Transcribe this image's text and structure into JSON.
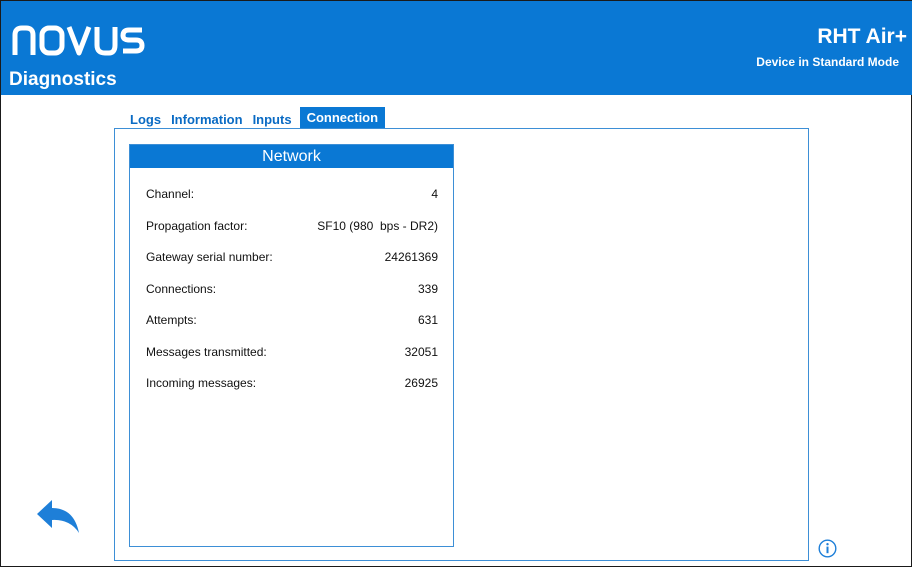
{
  "header": {
    "logo_text": "NOVUS",
    "page_title": "Diagnostics",
    "device_name": "RHT Air+",
    "device_mode": "Device in Standard Mode"
  },
  "tabs": [
    {
      "label": "Logs",
      "active": false
    },
    {
      "label": "Information",
      "active": false
    },
    {
      "label": "Inputs",
      "active": false
    },
    {
      "label": "Connection",
      "active": true
    }
  ],
  "network": {
    "title": "Network",
    "rows": [
      {
        "label": "Channel:",
        "value": "4"
      },
      {
        "label": "Propagation factor:",
        "value": "SF10 (980  bps - DR2)"
      },
      {
        "label": "Gateway serial number:",
        "value": "24261369"
      },
      {
        "label": "Connections:",
        "value": "339"
      },
      {
        "label": "Attempts:",
        "value": "631"
      },
      {
        "label": "Messages transmitted:",
        "value": "32051"
      },
      {
        "label": "Incoming messages:",
        "value": "26925"
      }
    ]
  },
  "icons": {
    "back": "back-arrow-icon",
    "info": "info-icon",
    "brand_color": "#0a78d4"
  }
}
